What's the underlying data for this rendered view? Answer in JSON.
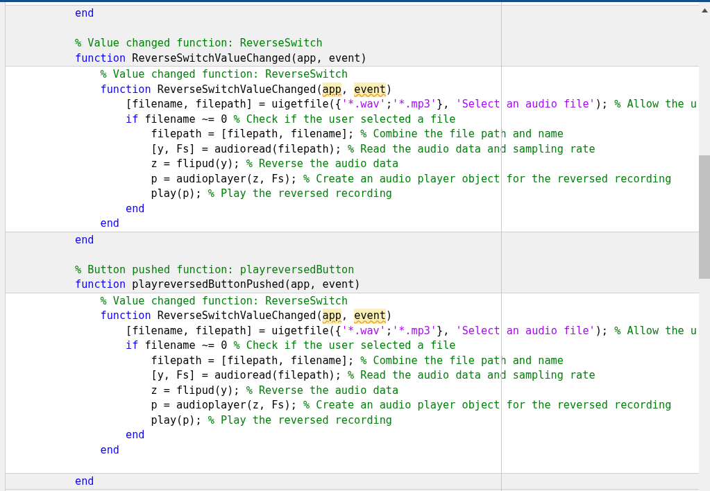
{
  "editor": {
    "blocks": [
      {
        "editable": false,
        "lines": [
          {
            "kind": "code",
            "tokens": [
              {
                "kind": "keyword",
                "text": "end"
              }
            ]
          },
          {
            "kind": "blank"
          },
          {
            "kind": "code",
            "tokens": [
              {
                "kind": "comment",
                "text": "% Value changed function: ReverseSwitch"
              }
            ]
          },
          {
            "kind": "code",
            "tokens": [
              {
                "kind": "keyword",
                "text": "function "
              },
              {
                "kind": "plain",
                "text": "ReverseSwitchValueChanged(app, event)"
              }
            ]
          }
        ]
      },
      {
        "editable": true,
        "lines": [
          {
            "kind": "code",
            "tokens": [
              {
                "kind": "comment",
                "text": "% Value changed function: ReverseSwitch"
              }
            ]
          },
          {
            "kind": "code",
            "tokens": [
              {
                "kind": "keyword",
                "text": "function "
              },
              {
                "kind": "plain",
                "text": "ReverseSwitchValueChanged("
              },
              {
                "kind": "plain",
                "text": "app",
                "highlighted": true
              },
              {
                "kind": "plain",
                "text": ", "
              },
              {
                "kind": "plain",
                "text": "event",
                "highlighted": true
              },
              {
                "kind": "plain",
                "text": ")"
              }
            ],
            "children": [
              {
                "kind": "code",
                "tokens": [
                  {
                    "kind": "plain",
                    "text": "[filename, filepath] = uigetfile({"
                  },
                  {
                    "kind": "string",
                    "text": "'*.wav'"
                  },
                  {
                    "kind": "plain",
                    "text": ";"
                  },
                  {
                    "kind": "string",
                    "text": "'*.mp3'"
                  },
                  {
                    "kind": "plain",
                    "text": "}, "
                  },
                  {
                    "kind": "string",
                    "text": "'Select an audio file'"
                  },
                  {
                    "kind": "plain",
                    "text": "); "
                  },
                  {
                    "kind": "comment",
                    "text": "% Allow the u"
                  }
                ]
              },
              {
                "kind": "code",
                "tokens": [
                  {
                    "kind": "keyword",
                    "text": "if "
                  },
                  {
                    "kind": "plain",
                    "text": "filename ~= 0 "
                  },
                  {
                    "kind": "comment",
                    "text": "% Check if the user selected a file"
                  }
                ],
                "children": [
                  {
                    "kind": "code",
                    "tokens": [
                      {
                        "kind": "plain",
                        "text": "filepath = [filepath, filename]; "
                      },
                      {
                        "kind": "comment",
                        "text": "% Combine the file path and name"
                      }
                    ]
                  },
                  {
                    "kind": "code",
                    "tokens": [
                      {
                        "kind": "plain",
                        "text": "[y, Fs] = audioread(filepath); "
                      },
                      {
                        "kind": "comment",
                        "text": "% Read the audio data and sampling rate"
                      }
                    ]
                  },
                  {
                    "kind": "code",
                    "tokens": [
                      {
                        "kind": "plain",
                        "text": "z = flipud(y); "
                      },
                      {
                        "kind": "comment",
                        "text": "% Reverse the audio data"
                      }
                    ]
                  },
                  {
                    "kind": "code",
                    "tokens": [
                      {
                        "kind": "plain",
                        "text": "p = audioplayer(z, Fs); "
                      },
                      {
                        "kind": "comment",
                        "text": "% Create an audio player object for the reversed recording"
                      }
                    ]
                  },
                  {
                    "kind": "code",
                    "tokens": [
                      {
                        "kind": "plain",
                        "text": "play(p); "
                      },
                      {
                        "kind": "comment",
                        "text": "% Play the reversed recording"
                      }
                    ]
                  }
                ]
              },
              {
                "kind": "code",
                "tokens": [
                  {
                    "kind": "keyword",
                    "text": "end"
                  }
                ]
              }
            ]
          },
          {
            "kind": "code",
            "tokens": [
              {
                "kind": "keyword",
                "text": "end"
              }
            ]
          }
        ]
      },
      {
        "editable": false,
        "lines": [
          {
            "kind": "code",
            "tokens": [
              {
                "kind": "keyword",
                "text": "end"
              }
            ]
          },
          {
            "kind": "blank"
          },
          {
            "kind": "code",
            "tokens": [
              {
                "kind": "comment",
                "text": "% Button pushed function: playreversedButton"
              }
            ]
          },
          {
            "kind": "code",
            "tokens": [
              {
                "kind": "keyword",
                "text": "function "
              },
              {
                "kind": "plain",
                "text": "playreversedButtonPushed(app, event)"
              }
            ]
          }
        ]
      },
      {
        "editable": true,
        "lines": [
          {
            "kind": "code",
            "tokens": [
              {
                "kind": "comment",
                "text": "% Value changed function: ReverseSwitch"
              }
            ]
          },
          {
            "kind": "code",
            "tokens": [
              {
                "kind": "keyword",
                "text": "function "
              },
              {
                "kind": "plain",
                "text": "ReverseSwitchValueChanged("
              },
              {
                "kind": "plain",
                "text": "app",
                "highlighted": true
              },
              {
                "kind": "plain",
                "text": ", "
              },
              {
                "kind": "plain",
                "text": "event",
                "highlighted": true
              },
              {
                "kind": "plain",
                "text": ")"
              }
            ],
            "children": [
              {
                "kind": "code",
                "tokens": [
                  {
                    "kind": "plain",
                    "text": "[filename, filepath] = uigetfile({"
                  },
                  {
                    "kind": "string",
                    "text": "'*.wav'"
                  },
                  {
                    "kind": "plain",
                    "text": ";"
                  },
                  {
                    "kind": "string",
                    "text": "'*.mp3'"
                  },
                  {
                    "kind": "plain",
                    "text": "}, "
                  },
                  {
                    "kind": "string",
                    "text": "'Select an audio file'"
                  },
                  {
                    "kind": "plain",
                    "text": "); "
                  },
                  {
                    "kind": "comment",
                    "text": "% Allow the u"
                  }
                ]
              },
              {
                "kind": "code",
                "tokens": [
                  {
                    "kind": "keyword",
                    "text": "if "
                  },
                  {
                    "kind": "plain",
                    "text": "filename ~= 0 "
                  },
                  {
                    "kind": "comment",
                    "text": "% Check if the user selected a file"
                  }
                ],
                "children": [
                  {
                    "kind": "code",
                    "tokens": [
                      {
                        "kind": "plain",
                        "text": "filepath = [filepath, filename]; "
                      },
                      {
                        "kind": "comment",
                        "text": "% Combine the file path and name"
                      }
                    ]
                  },
                  {
                    "kind": "code",
                    "tokens": [
                      {
                        "kind": "plain",
                        "text": "[y, Fs] = audioread(filepath); "
                      },
                      {
                        "kind": "comment",
                        "text": "% Read the audio data and sampling rate"
                      }
                    ]
                  },
                  {
                    "kind": "code",
                    "tokens": [
                      {
                        "kind": "plain",
                        "text": "z = flipud(y); "
                      },
                      {
                        "kind": "comment",
                        "text": "% Reverse the audio data"
                      }
                    ]
                  },
                  {
                    "kind": "code",
                    "tokens": [
                      {
                        "kind": "plain",
                        "text": "p = audioplayer(z, Fs); "
                      },
                      {
                        "kind": "comment",
                        "text": "% Create an audio player object for the reversed recording"
                      }
                    ]
                  },
                  {
                    "kind": "code",
                    "tokens": [
                      {
                        "kind": "plain",
                        "text": "play(p); "
                      },
                      {
                        "kind": "comment",
                        "text": "% Play the reversed recording"
                      }
                    ]
                  }
                ]
              },
              {
                "kind": "code",
                "tokens": [
                  {
                    "kind": "keyword",
                    "text": "end"
                  }
                ]
              }
            ]
          },
          {
            "kind": "code",
            "tokens": [
              {
                "kind": "keyword",
                "text": "end"
              }
            ]
          },
          {
            "kind": "blank"
          }
        ]
      },
      {
        "editable": false,
        "lines": [
          {
            "kind": "code",
            "tokens": [
              {
                "kind": "keyword",
                "text": "end"
              }
            ]
          }
        ]
      }
    ]
  }
}
